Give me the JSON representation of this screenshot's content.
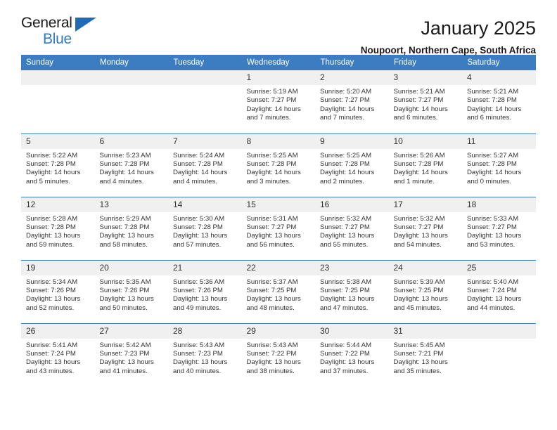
{
  "logo": {
    "line1": "General",
    "line2": "Blue",
    "triangle": "triangle-icon"
  },
  "header": {
    "title": "January 2025",
    "subtitle": "Noupoort, Northern Cape, South Africa"
  },
  "colors": {
    "header_blue": "#3b7dc0",
    "logo_blue": "#2e7bc4",
    "daynum_bg": "#f0f0f0",
    "text": "#333333"
  },
  "weekdays": [
    "Sunday",
    "Monday",
    "Tuesday",
    "Wednesday",
    "Thursday",
    "Friday",
    "Saturday"
  ],
  "labels": {
    "sunrise": "Sunrise:",
    "sunset": "Sunset:",
    "daylight": "Daylight:"
  },
  "weeks": [
    [
      {
        "day": ""
      },
      {
        "day": ""
      },
      {
        "day": ""
      },
      {
        "day": "1",
        "sunrise": "Sunrise: 5:19 AM",
        "sunset": "Sunset: 7:27 PM",
        "daylight": "Daylight: 14 hours and 7 minutes."
      },
      {
        "day": "2",
        "sunrise": "Sunrise: 5:20 AM",
        "sunset": "Sunset: 7:27 PM",
        "daylight": "Daylight: 14 hours and 7 minutes."
      },
      {
        "day": "3",
        "sunrise": "Sunrise: 5:21 AM",
        "sunset": "Sunset: 7:27 PM",
        "daylight": "Daylight: 14 hours and 6 minutes."
      },
      {
        "day": "4",
        "sunrise": "Sunrise: 5:21 AM",
        "sunset": "Sunset: 7:28 PM",
        "daylight": "Daylight: 14 hours and 6 minutes."
      }
    ],
    [
      {
        "day": "5",
        "sunrise": "Sunrise: 5:22 AM",
        "sunset": "Sunset: 7:28 PM",
        "daylight": "Daylight: 14 hours and 5 minutes."
      },
      {
        "day": "6",
        "sunrise": "Sunrise: 5:23 AM",
        "sunset": "Sunset: 7:28 PM",
        "daylight": "Daylight: 14 hours and 4 minutes."
      },
      {
        "day": "7",
        "sunrise": "Sunrise: 5:24 AM",
        "sunset": "Sunset: 7:28 PM",
        "daylight": "Daylight: 14 hours and 4 minutes."
      },
      {
        "day": "8",
        "sunrise": "Sunrise: 5:25 AM",
        "sunset": "Sunset: 7:28 PM",
        "daylight": "Daylight: 14 hours and 3 minutes."
      },
      {
        "day": "9",
        "sunrise": "Sunrise: 5:25 AM",
        "sunset": "Sunset: 7:28 PM",
        "daylight": "Daylight: 14 hours and 2 minutes."
      },
      {
        "day": "10",
        "sunrise": "Sunrise: 5:26 AM",
        "sunset": "Sunset: 7:28 PM",
        "daylight": "Daylight: 14 hours and 1 minute."
      },
      {
        "day": "11",
        "sunrise": "Sunrise: 5:27 AM",
        "sunset": "Sunset: 7:28 PM",
        "daylight": "Daylight: 14 hours and 0 minutes."
      }
    ],
    [
      {
        "day": "12",
        "sunrise": "Sunrise: 5:28 AM",
        "sunset": "Sunset: 7:28 PM",
        "daylight": "Daylight: 13 hours and 59 minutes."
      },
      {
        "day": "13",
        "sunrise": "Sunrise: 5:29 AM",
        "sunset": "Sunset: 7:28 PM",
        "daylight": "Daylight: 13 hours and 58 minutes."
      },
      {
        "day": "14",
        "sunrise": "Sunrise: 5:30 AM",
        "sunset": "Sunset: 7:28 PM",
        "daylight": "Daylight: 13 hours and 57 minutes."
      },
      {
        "day": "15",
        "sunrise": "Sunrise: 5:31 AM",
        "sunset": "Sunset: 7:27 PM",
        "daylight": "Daylight: 13 hours and 56 minutes."
      },
      {
        "day": "16",
        "sunrise": "Sunrise: 5:32 AM",
        "sunset": "Sunset: 7:27 PM",
        "daylight": "Daylight: 13 hours and 55 minutes."
      },
      {
        "day": "17",
        "sunrise": "Sunrise: 5:32 AM",
        "sunset": "Sunset: 7:27 PM",
        "daylight": "Daylight: 13 hours and 54 minutes."
      },
      {
        "day": "18",
        "sunrise": "Sunrise: 5:33 AM",
        "sunset": "Sunset: 7:27 PM",
        "daylight": "Daylight: 13 hours and 53 minutes."
      }
    ],
    [
      {
        "day": "19",
        "sunrise": "Sunrise: 5:34 AM",
        "sunset": "Sunset: 7:26 PM",
        "daylight": "Daylight: 13 hours and 52 minutes."
      },
      {
        "day": "20",
        "sunrise": "Sunrise: 5:35 AM",
        "sunset": "Sunset: 7:26 PM",
        "daylight": "Daylight: 13 hours and 50 minutes."
      },
      {
        "day": "21",
        "sunrise": "Sunrise: 5:36 AM",
        "sunset": "Sunset: 7:26 PM",
        "daylight": "Daylight: 13 hours and 49 minutes."
      },
      {
        "day": "22",
        "sunrise": "Sunrise: 5:37 AM",
        "sunset": "Sunset: 7:25 PM",
        "daylight": "Daylight: 13 hours and 48 minutes."
      },
      {
        "day": "23",
        "sunrise": "Sunrise: 5:38 AM",
        "sunset": "Sunset: 7:25 PM",
        "daylight": "Daylight: 13 hours and 47 minutes."
      },
      {
        "day": "24",
        "sunrise": "Sunrise: 5:39 AM",
        "sunset": "Sunset: 7:25 PM",
        "daylight": "Daylight: 13 hours and 45 minutes."
      },
      {
        "day": "25",
        "sunrise": "Sunrise: 5:40 AM",
        "sunset": "Sunset: 7:24 PM",
        "daylight": "Daylight: 13 hours and 44 minutes."
      }
    ],
    [
      {
        "day": "26",
        "sunrise": "Sunrise: 5:41 AM",
        "sunset": "Sunset: 7:24 PM",
        "daylight": "Daylight: 13 hours and 43 minutes."
      },
      {
        "day": "27",
        "sunrise": "Sunrise: 5:42 AM",
        "sunset": "Sunset: 7:23 PM",
        "daylight": "Daylight: 13 hours and 41 minutes."
      },
      {
        "day": "28",
        "sunrise": "Sunrise: 5:43 AM",
        "sunset": "Sunset: 7:23 PM",
        "daylight": "Daylight: 13 hours and 40 minutes."
      },
      {
        "day": "29",
        "sunrise": "Sunrise: 5:43 AM",
        "sunset": "Sunset: 7:22 PM",
        "daylight": "Daylight: 13 hours and 38 minutes."
      },
      {
        "day": "30",
        "sunrise": "Sunrise: 5:44 AM",
        "sunset": "Sunset: 7:22 PM",
        "daylight": "Daylight: 13 hours and 37 minutes."
      },
      {
        "day": "31",
        "sunrise": "Sunrise: 5:45 AM",
        "sunset": "Sunset: 7:21 PM",
        "daylight": "Daylight: 13 hours and 35 minutes."
      },
      {
        "day": ""
      }
    ]
  ]
}
